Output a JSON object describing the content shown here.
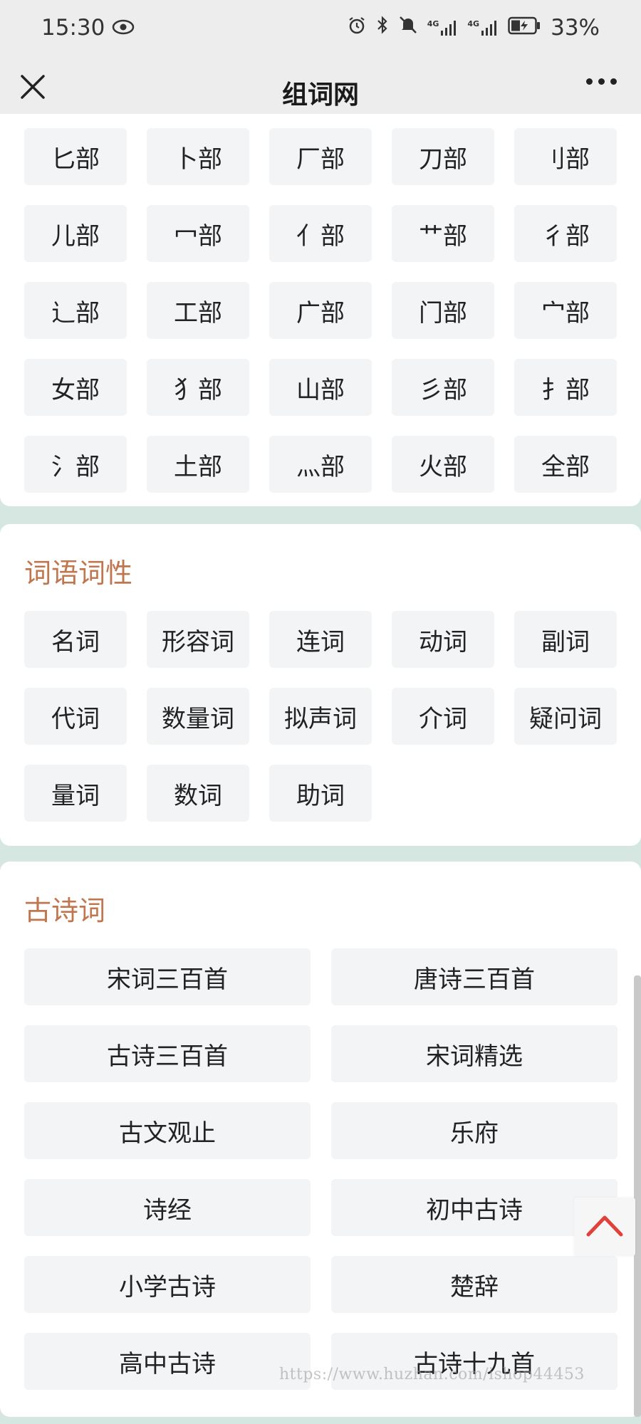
{
  "status": {
    "time": "15:30",
    "battery": "33%",
    "signal1": "4G",
    "signal2": "4G"
  },
  "nav": {
    "title": "组词网"
  },
  "radicals": {
    "rows": [
      [
        "匕部",
        "卜部",
        "厂部",
        "刀部",
        "刂部"
      ],
      [
        "儿部",
        "冖部",
        "亻部",
        "艹部",
        "彳部"
      ],
      [
        "辶部",
        "工部",
        "广部",
        "门部",
        "宀部"
      ],
      [
        "女部",
        "犭部",
        "山部",
        "彡部",
        "扌部"
      ],
      [
        "氵部",
        "土部",
        "灬部",
        "火部",
        "全部"
      ]
    ]
  },
  "pos": {
    "title": "词语词性",
    "items": [
      "名词",
      "形容词",
      "连词",
      "动词",
      "副词",
      "代词",
      "数量词",
      "拟声词",
      "介词",
      "疑问词",
      "量词",
      "数词",
      "助词"
    ]
  },
  "poetry": {
    "title": "古诗词",
    "items": [
      "宋词三百首",
      "唐诗三百首",
      "古诗三百首",
      "宋词精选",
      "古文观止",
      "乐府",
      "诗经",
      "初中古诗",
      "小学古诗",
      "楚辞",
      "高中古诗",
      "古诗十九首"
    ]
  },
  "watermark": "https://www.huzhan.com/ishop44453",
  "colors": {
    "section_title": "#c0764e",
    "background": "#d6e6e1",
    "back_top_arrow": "#e0413a"
  }
}
